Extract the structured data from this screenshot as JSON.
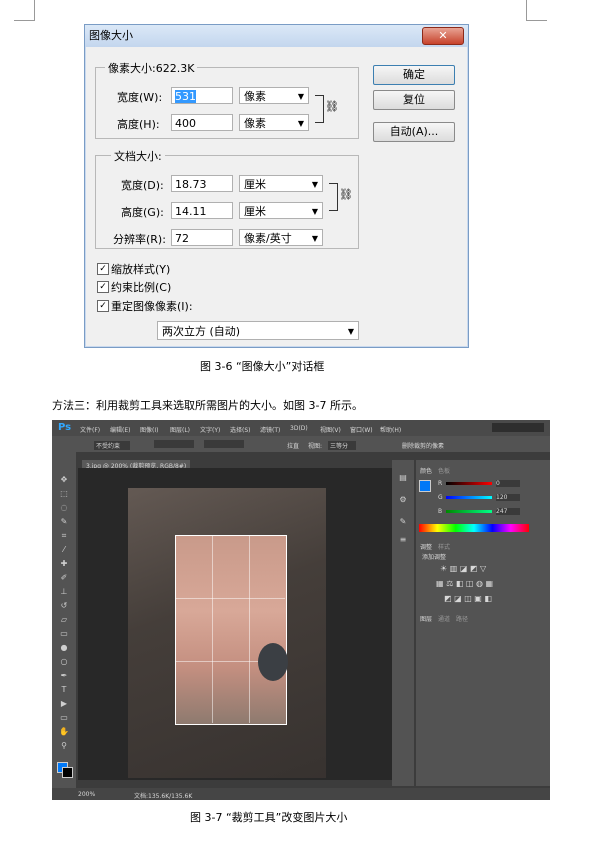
{
  "dialog": {
    "title": "图像大小",
    "close": "✕",
    "pixel_dimensions_label": "像素大小:622.3K",
    "width_label": "宽度(W):",
    "width_value": "531",
    "width_unit": "像素",
    "height_label": "高度(H):",
    "height_value": "400",
    "height_unit": "像素",
    "document_size_label": "文档大小:",
    "doc_width_label": "宽度(D):",
    "doc_width_value": "18.73",
    "doc_width_unit": "厘米",
    "doc_height_label": "高度(G):",
    "doc_height_value": "14.11",
    "doc_height_unit": "厘米",
    "resolution_label": "分辨率(R):",
    "resolution_value": "72",
    "resolution_unit": "像素/英寸",
    "ok_button": "确定",
    "reset_button": "复位",
    "auto_button": "自动(A)...",
    "scale_styles": "缩放样式(Y)",
    "constrain": "约束比例(C)",
    "resample": "重定图像像素(I):",
    "resample_method": "两次立方 (自动)"
  },
  "caption1": "图 3-6 “图像大小”对话框",
  "paragraph": "方法三：利用裁剪工具来选取所需图片的大小。如图 3-7 所示。",
  "ps": {
    "logo": "Ps",
    "menu": [
      "文件(F)",
      "编辑(E)",
      "图像(I)",
      "图层(L)",
      "文字(Y)",
      "选择(S)",
      "滤镜(T)",
      "3D(D)",
      "视图(V)",
      "窗口(W)",
      "帮助(H)"
    ],
    "options_ratio": "不受约束",
    "options_straighten": "拉直",
    "options_view_label": "视图:",
    "options_view_value": "三等分",
    "options_delete": "删除裁剪的像素",
    "doc_tab": "3.jpg @ 200% (裁剪预览, RGB/8#)",
    "zoom": "200%",
    "doc_info": "文档:135.6K/135.6K",
    "color_tab": "颜色",
    "swatches_tab": "色板",
    "adjust_tab": "调整",
    "styles_tab": "样式",
    "add_adjust": "添加调整",
    "layers_tab": "图层",
    "channels_tab": "通道",
    "paths_tab": "路径",
    "r_label": "R",
    "g_label": "G",
    "b_label": "B",
    "r_value": "0",
    "g_value": "120",
    "b_value": "247",
    "fg_color": "#0078f7"
  },
  "caption2": "图 3-7 “裁剪工具”改变图片大小"
}
